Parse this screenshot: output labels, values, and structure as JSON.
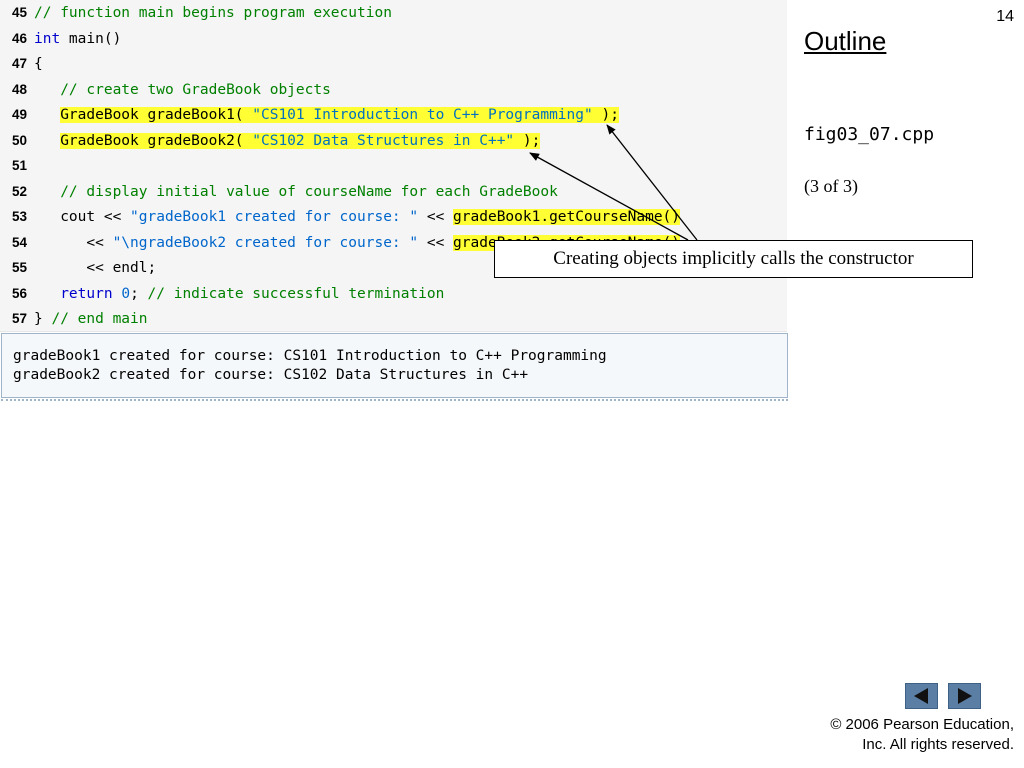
{
  "slide_number": "14",
  "sidebar": {
    "outline_label": "Outline",
    "file_name": "fig03_07.cpp",
    "page_indicator": "(3 of 3)"
  },
  "code": {
    "lines": [
      {
        "number": "45",
        "segments": [
          {
            "text": "// function main begins program execution",
            "style": "comment"
          }
        ]
      },
      {
        "number": "46",
        "segments": [
          {
            "text": "int",
            "style": "keyword"
          },
          {
            "text": " main()",
            "style": "plain"
          }
        ]
      },
      {
        "number": "47",
        "segments": [
          {
            "text": "{",
            "style": "plain"
          }
        ]
      },
      {
        "number": "48",
        "segments": [
          {
            "text": "   ",
            "style": "plain"
          },
          {
            "text": "// create two GradeBook objects",
            "style": "comment"
          }
        ]
      },
      {
        "number": "49",
        "segments": [
          {
            "text": "   ",
            "style": "plain"
          },
          {
            "text": "GradeBook gradeBook1( ",
            "style": "plain",
            "highlight": true
          },
          {
            "text": "\"CS101 Introduction to C++ Programming\"",
            "style": "string",
            "highlight": true
          },
          {
            "text": " );",
            "style": "plain",
            "highlight": true
          }
        ]
      },
      {
        "number": "50",
        "segments": [
          {
            "text": "   ",
            "style": "plain"
          },
          {
            "text": "GradeBook gradeBook2( ",
            "style": "plain",
            "highlight": true
          },
          {
            "text": "\"CS102 Data Structures in C++\"",
            "style": "string",
            "highlight": true
          },
          {
            "text": " );",
            "style": "plain",
            "highlight": true
          }
        ]
      },
      {
        "number": "51",
        "segments": []
      },
      {
        "number": "52",
        "segments": [
          {
            "text": "   ",
            "style": "plain"
          },
          {
            "text": "// display initial value of courseName for each GradeBook",
            "style": "comment"
          }
        ]
      },
      {
        "number": "53",
        "segments": [
          {
            "text": "   cout << ",
            "style": "plain"
          },
          {
            "text": "\"gradeBook1 created for course: \"",
            "style": "string"
          },
          {
            "text": " << ",
            "style": "plain"
          },
          {
            "text": "gradeBook1.getCourseName()",
            "style": "plain",
            "highlight": true
          }
        ]
      },
      {
        "number": "54",
        "segments": [
          {
            "text": "      << ",
            "style": "plain"
          },
          {
            "text": "\"\\ngradeBook2 created for course: \"",
            "style": "string"
          },
          {
            "text": " << ",
            "style": "plain"
          },
          {
            "text": "gradeBook2.getCourseName()",
            "style": "plain",
            "highlight": true
          }
        ]
      },
      {
        "number": "55",
        "segments": [
          {
            "text": "      << endl;",
            "style": "plain"
          }
        ]
      },
      {
        "number": "56",
        "segments": [
          {
            "text": "   ",
            "style": "plain"
          },
          {
            "text": "return",
            "style": "keyword"
          },
          {
            "text": " ",
            "style": "plain"
          },
          {
            "text": "0",
            "style": "string"
          },
          {
            "text": "; ",
            "style": "plain"
          },
          {
            "text": "// indicate successful termination",
            "style": "comment"
          }
        ]
      },
      {
        "number": "57",
        "segments": [
          {
            "text": "} ",
            "style": "plain"
          },
          {
            "text": "// end main",
            "style": "comment"
          }
        ]
      }
    ]
  },
  "output": {
    "lines": [
      "gradeBook1 created for course: CS101 Introduction to C++ Programming",
      "gradeBook2 created for course: CS102 Data Structures in C++"
    ]
  },
  "callout": {
    "text": "Creating objects implicitly calls the constructor"
  },
  "navigation": {
    "previous_icon": "arrow-left-icon",
    "next_icon": "arrow-right-icon",
    "button_color": "#5b7fa4"
  },
  "footer": {
    "copyright_line1": "© 2006 Pearson Education,",
    "copyright_line2": "Inc.  All rights reserved."
  },
  "colors": {
    "comment": "#008000",
    "keyword": "#0000cc",
    "string": "#0066cc",
    "highlight": "#ffff33",
    "code_background": "#f5f5f5"
  }
}
